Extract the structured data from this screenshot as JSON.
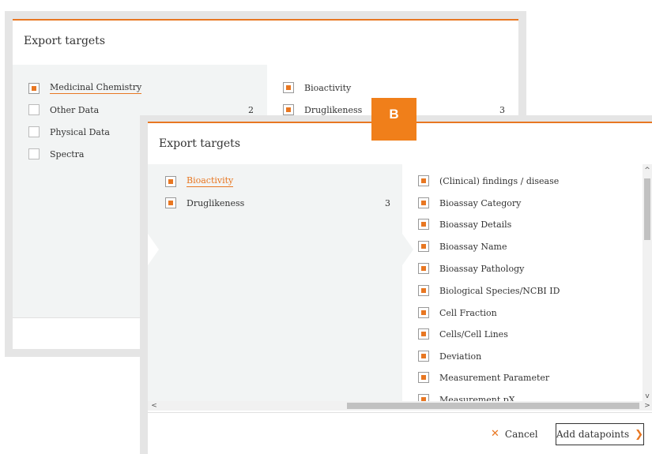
{
  "back_dialog": {
    "title": "Export targets",
    "left_items": [
      {
        "label": "Medicinal Chemistry",
        "checked": true,
        "count": ""
      },
      {
        "label": "Other Data",
        "checked": false,
        "count": "2"
      },
      {
        "label": "Physical Data",
        "checked": false,
        "count": ""
      },
      {
        "label": "Spectra",
        "checked": false,
        "count": ""
      }
    ],
    "right_items": [
      {
        "label": "Bioactivity",
        "checked": true,
        "count": ""
      },
      {
        "label": "Druglikeness",
        "checked": true,
        "count": "3"
      }
    ]
  },
  "badge": {
    "label": "B",
    "color": "#f07f1a"
  },
  "front_dialog": {
    "title": "Export targets",
    "left_items": [
      {
        "label": "Bioactivity",
        "checked": true,
        "count": ""
      },
      {
        "label": "Druglikeness",
        "checked": true,
        "count": "3"
      }
    ],
    "right_items": [
      {
        "label": "(Clinical) findings / disease",
        "checked": true
      },
      {
        "label": "Bioassay Category",
        "checked": true
      },
      {
        "label": "Bioassay Details",
        "checked": true
      },
      {
        "label": "Bioassay Name",
        "checked": true
      },
      {
        "label": "Bioassay Pathology",
        "checked": true
      },
      {
        "label": "Biological Species/NCBI ID",
        "checked": true
      },
      {
        "label": "Cell Fraction",
        "checked": true
      },
      {
        "label": "Cells/Cell Lines",
        "checked": true
      },
      {
        "label": "Deviation",
        "checked": true
      },
      {
        "label": "Measurement Parameter",
        "checked": true
      },
      {
        "label": "Measurement pX",
        "checked": true
      }
    ],
    "cancel_label": "Cancel",
    "add_label": "Add datapoints",
    "scroll_up": "^",
    "scroll_down": "v",
    "scroll_left": "<",
    "scroll_right": ">"
  },
  "colors": {
    "accent": "#e87722",
    "panel_bg": "#f2f4f4",
    "frame": "#e5e5e5"
  }
}
